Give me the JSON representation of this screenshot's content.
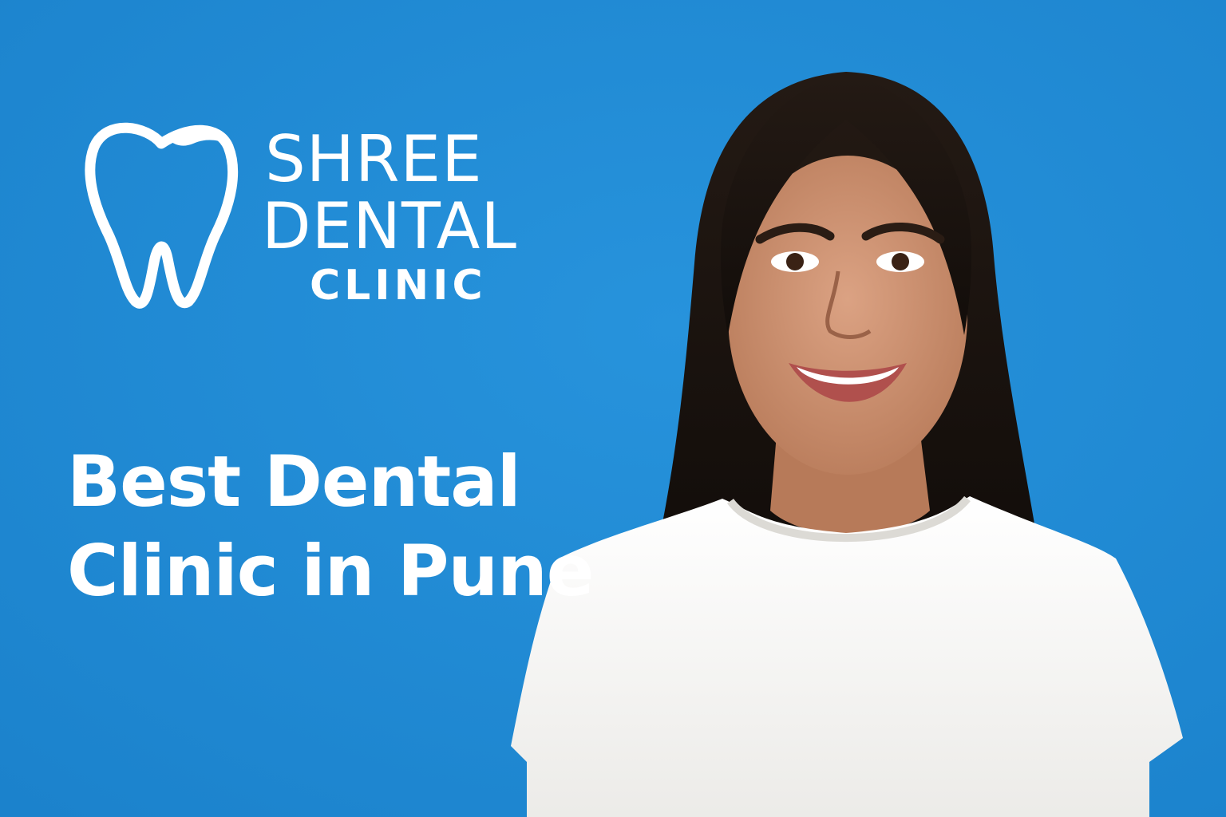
{
  "brand": {
    "logo_icon": "tooth-icon",
    "line1": "SHREE",
    "line2": "DENTAL",
    "line3": "CLINIC"
  },
  "headline": {
    "line1": "Best Dental",
    "line2": "Clinic in Pune"
  },
  "colors": {
    "background": "#1f88d2",
    "text": "#ffffff",
    "shirt": "#f6f6f4",
    "hair": "#1a1410",
    "skin": "#c98f6c"
  }
}
